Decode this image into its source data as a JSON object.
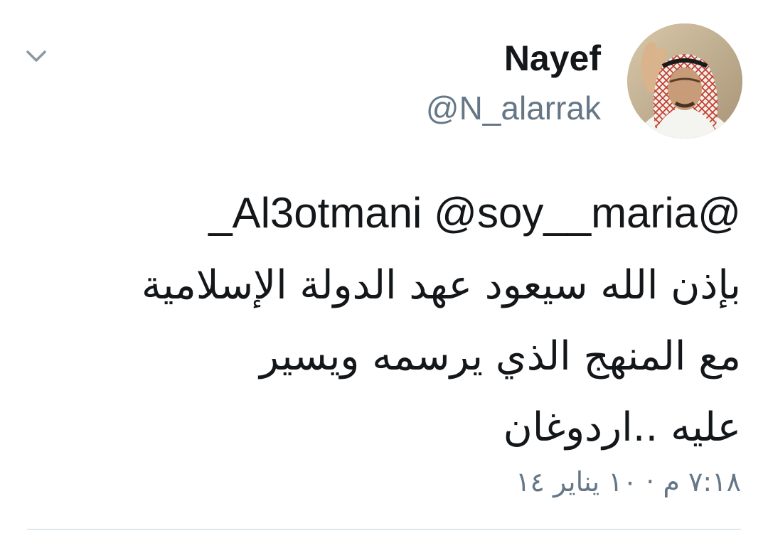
{
  "tweet": {
    "author": {
      "display_name": "Nayef",
      "handle": "@N_alarrak"
    },
    "mentions": [
      "_Al3otmani",
      "@soy__maria@"
    ],
    "text_lines": [
      "بإذن الله سيعود عهد الدولة الإسلامية",
      "مع المنهج الذي يرسمه ويسير",
      "عليه ..اردوغان"
    ],
    "timestamp": "٧:١٨ م · ١٠ يناير ١٤"
  },
  "icons": {
    "menu": "chevron-down-icon"
  },
  "colors": {
    "text_primary": "#14171a",
    "text_secondary": "#657786",
    "background": "#ffffff",
    "divider": "#e1e8ed"
  }
}
